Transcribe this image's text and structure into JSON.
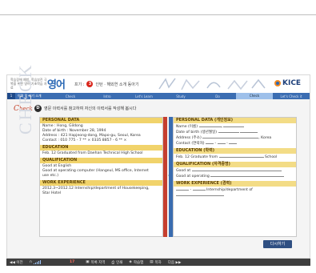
{
  "app": {
    "brand_small": "학습장애 예방, 학습부진 극복을 위한 영어 기초학습 자료",
    "brand_logo": "영어",
    "crumb_prefix": "프기 :",
    "crumb_num": "3",
    "crumb_text": "인턴 · 해외연 소개 동아기",
    "kice": "KICE"
  },
  "nav": {
    "number": "1",
    "title": "이력 및 자기 소개",
    "items": [
      "Check",
      "Intro",
      "Let's Learn",
      "Study",
      "Do",
      "Check",
      "Let's Check it"
    ],
    "active_index": 5
  },
  "main": {
    "check_title_first": "C",
    "check_title_rest": "heck",
    "step_marker": "D",
    "instruction": "영문 이력서를 참고하여 자신의 이력서를 작성해 봅시다",
    "watermark": "CHECK",
    "answer_button": "다시하기"
  },
  "left_panel": {
    "personal_head": "PERSONAL DATA",
    "personal_lines": [
      "Name : Hong, Gildong",
      "Date of birth : November 28, 1994",
      "Address : 421 Hapjeong-dong, Mapo-gu, Seoul, Korea",
      "Contact : 010 775 - 7 ** ×   0335 8857 - 6 ** ×"
    ],
    "education_head": "EDUCATION",
    "education_lines": [
      "Feb. 12  Graduated from Daehan Technical High School"
    ],
    "qualification_head": "QUALIFICATION",
    "qualification_lines": [
      "Good at English",
      "Good at operating computer (Hangeul, MS office, Internet",
      "use etc.)"
    ],
    "work_head": "WORK EXPERIENCE",
    "work_lines": [
      "2012.3~2012.12 Internship/department of Housekeeping,",
      "Star Hotel"
    ]
  },
  "right_panel": {
    "personal_head": "PERSONAL DATA (개인정보)",
    "name_label": "Name (이름)",
    "birth_label": "Date of birth (생년월일)",
    "address_label": "Address (주소)",
    "address_suffix": ", Korea",
    "contact_label": "Contact (연락처)",
    "education_head": "EDUCATION (학력)",
    "education_prefix": "Feb. 12  Graduate from",
    "education_suffix": "School",
    "qualification_head": "QUALIFICATION (자격증명)",
    "qual_line1": "Good at",
    "qual_line2": "Good at operating",
    "work_head": "WORK EXPERIENCE (경력)",
    "work_middle": "Internship/department of"
  },
  "bottom_bar": {
    "prev": "◀◀ 이전",
    "volume_icon": "headphone-icon",
    "page": "17",
    "items": [
      "목록 지역",
      "인쇄",
      "학습맵",
      "목차",
      "다음 ▶▶"
    ]
  }
}
